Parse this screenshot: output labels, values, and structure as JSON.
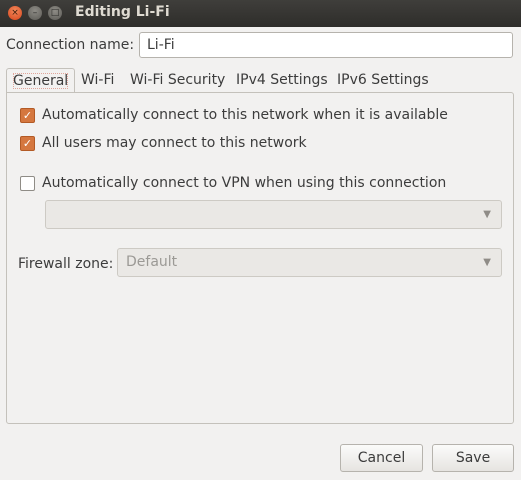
{
  "window": {
    "title": "Editing Li-Fi",
    "close_symbol": "×",
    "min_symbol": "–",
    "max_symbol": "□"
  },
  "connection": {
    "label": "Connection name:",
    "value": "Li-Fi"
  },
  "tabs": [
    {
      "label": "General",
      "active": true
    },
    {
      "label": "Wi-Fi",
      "active": false
    },
    {
      "label": "Wi-Fi Security",
      "active": false
    },
    {
      "label": "IPv4 Settings",
      "active": false
    },
    {
      "label": "IPv6 Settings",
      "active": false
    }
  ],
  "general": {
    "auto_connect": {
      "label": "Automatically connect to this network when it is available",
      "checked": true
    },
    "all_users": {
      "label": "All users may connect to this network",
      "checked": true
    },
    "auto_vpn": {
      "label": "Automatically connect to VPN when using this connection",
      "checked": false
    },
    "vpn_select_value": "",
    "firewall_label": "Firewall zone:",
    "firewall_value": "Default"
  },
  "buttons": {
    "cancel": "Cancel",
    "save": "Save"
  },
  "colors": {
    "checkbox_checked": "#d5773f",
    "titlebar": "#3c3b37",
    "close_button": "#e2552a"
  }
}
